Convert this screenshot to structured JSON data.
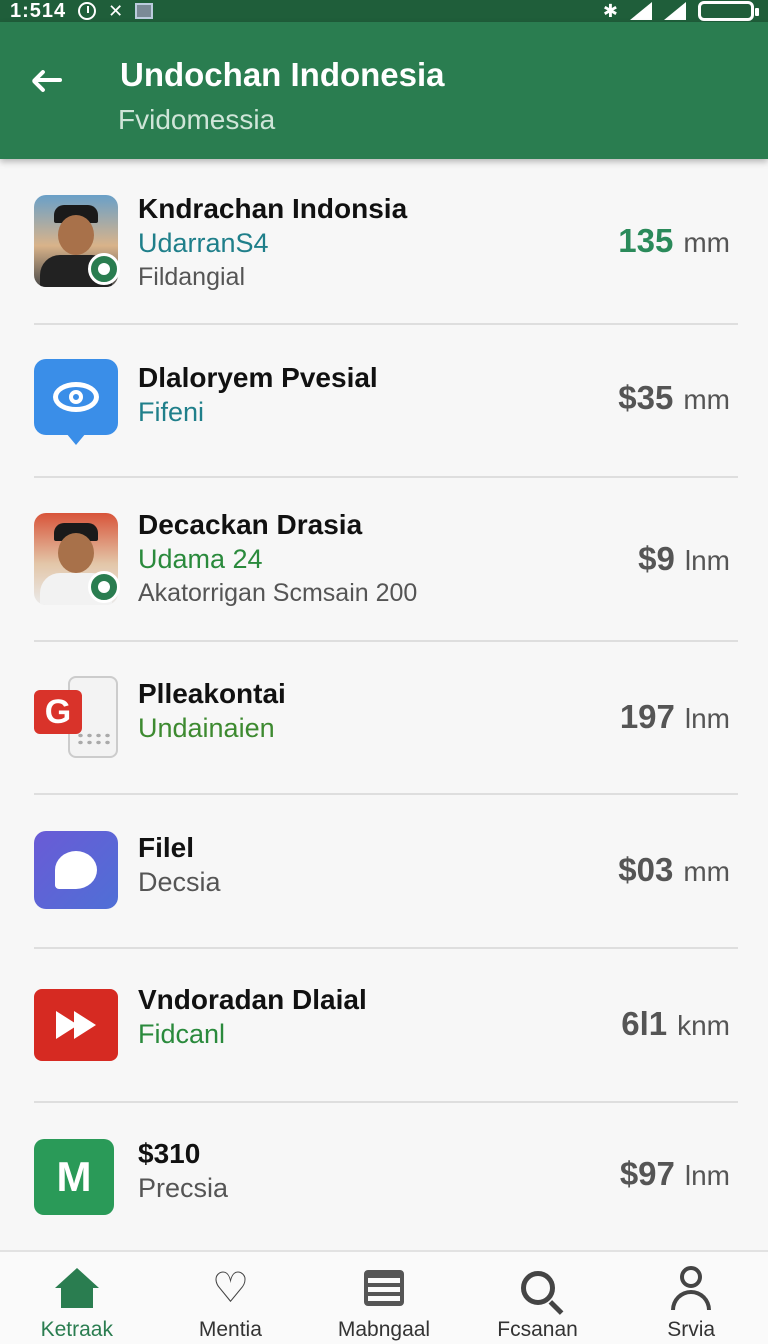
{
  "status_bar": {
    "time": "1:514",
    "icons": [
      "clock-icon",
      "no-notifications-icon",
      "image-icon",
      "bluetooth-icon",
      "signal-icon",
      "battery-icon"
    ]
  },
  "app_bar": {
    "title": "Undochan Indonesia",
    "subtitle": "Fvidomessia"
  },
  "items": [
    {
      "title": "Kndrachan Indonsia",
      "subtitle": "UdarranS4",
      "description": "Fildangial",
      "amount": "135",
      "unit": "mm",
      "icon": "avatar-photo"
    },
    {
      "title": "Dlaloryem Pvesial",
      "subtitle": "Fifeni",
      "description": "",
      "amount": "$35",
      "unit": "mm",
      "icon": "eye-icon"
    },
    {
      "title": "Decackan Drasia",
      "subtitle": "Udama 24",
      "description": "Akatorrigan Scmsain 200",
      "amount": "$9",
      "unit": "lnm",
      "icon": "avatar-photo"
    },
    {
      "title": "Plleakontai",
      "subtitle": "Undainaien",
      "description": "",
      "amount": "197",
      "unit": "lnm",
      "icon": "g-app-icon"
    },
    {
      "title": "Filel",
      "subtitle": "Decsia",
      "description": "",
      "amount": "$03",
      "unit": "mm",
      "icon": "chat-icon"
    },
    {
      "title": "Vndoradan Dlaial",
      "subtitle": "Fidcanl",
      "description": "",
      "amount": "6l1",
      "unit": "knm",
      "icon": "play-icon"
    },
    {
      "title": "$310",
      "subtitle": "Precsia",
      "description": "",
      "amount": "$97",
      "unit": "lnm",
      "icon": "m-app-icon"
    }
  ],
  "bottom_nav": [
    {
      "label": "Ketraak",
      "icon": "home-icon",
      "active": true
    },
    {
      "label": "Mentia",
      "icon": "heart-icon",
      "active": false
    },
    {
      "label": "Mabngaal",
      "icon": "list-icon",
      "active": false
    },
    {
      "label": "Fcsanan",
      "icon": "search-icon",
      "active": false
    },
    {
      "label": "Srvia",
      "icon": "person-icon",
      "active": false
    }
  ],
  "colors": {
    "app_bar": "#2a7d50",
    "status_bar": "#1f5e3a",
    "accent_green": "#2a8a5a",
    "teal": "#1f7f8a"
  }
}
